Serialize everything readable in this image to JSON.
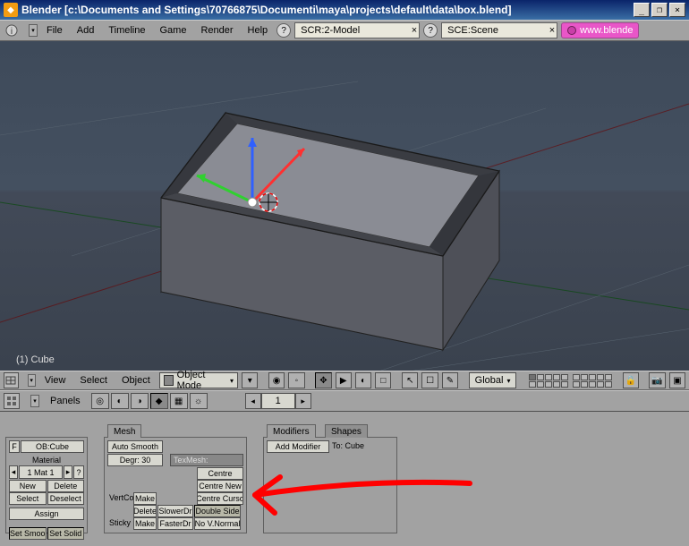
{
  "titlebar": {
    "app": "Blender",
    "path": "[c:\\Documents and Settings\\70766875\\Documenti\\maya\\projects\\default\\data\\box.blend]",
    "min": "_",
    "restore": "❐",
    "close": "×"
  },
  "menubar": {
    "file": "File",
    "add": "Add",
    "timeline": "Timeline",
    "game": "Game",
    "render": "Render",
    "help": "Help",
    "scr_selector": "SCR:2-Model",
    "sce_selector": "SCE:Scene",
    "badge": "www.blende",
    "close_x": "×"
  },
  "viewport": {
    "object_label": "(1) Cube"
  },
  "vp_header": {
    "view": "View",
    "select": "Select",
    "object": "Object",
    "mode": "Object Mode",
    "orient": "Global"
  },
  "panels_header": {
    "label": "Panels",
    "num": "1"
  },
  "buttons": {
    "linkmat": {
      "f_label": "F",
      "ob_field": "OB:Cube",
      "material": "Material",
      "mat_field": "1 Mat 1",
      "new": "New",
      "delete": "Delete",
      "select": "Select",
      "deselect": "Deselect",
      "assign": "Assign",
      "set_smooth": "Set Smoo",
      "set_solid": "Set Solid"
    },
    "mesh": {
      "tab": "Mesh",
      "auto_smooth": "Auto Smooth",
      "degr": "Degr: 30",
      "vertco": "VertCo",
      "sticky": "Sticky",
      "make1": "Make",
      "make2": "Make",
      "delete": "Delete",
      "texmesh": "TexMesh:",
      "centre": "Centre",
      "centre_new": "Centre New",
      "centre_curso": "Centre Curso",
      "slower_dr": "SlowerDr",
      "faster_dr": "FasterDr",
      "double_sided": "Double Side",
      "no_vnormal": "No V.Normal"
    },
    "modifiers": {
      "tab": "Modifiers",
      "shapes": "Shapes",
      "add_modifier": "Add Modifier",
      "to_cube": "To: Cube"
    }
  }
}
